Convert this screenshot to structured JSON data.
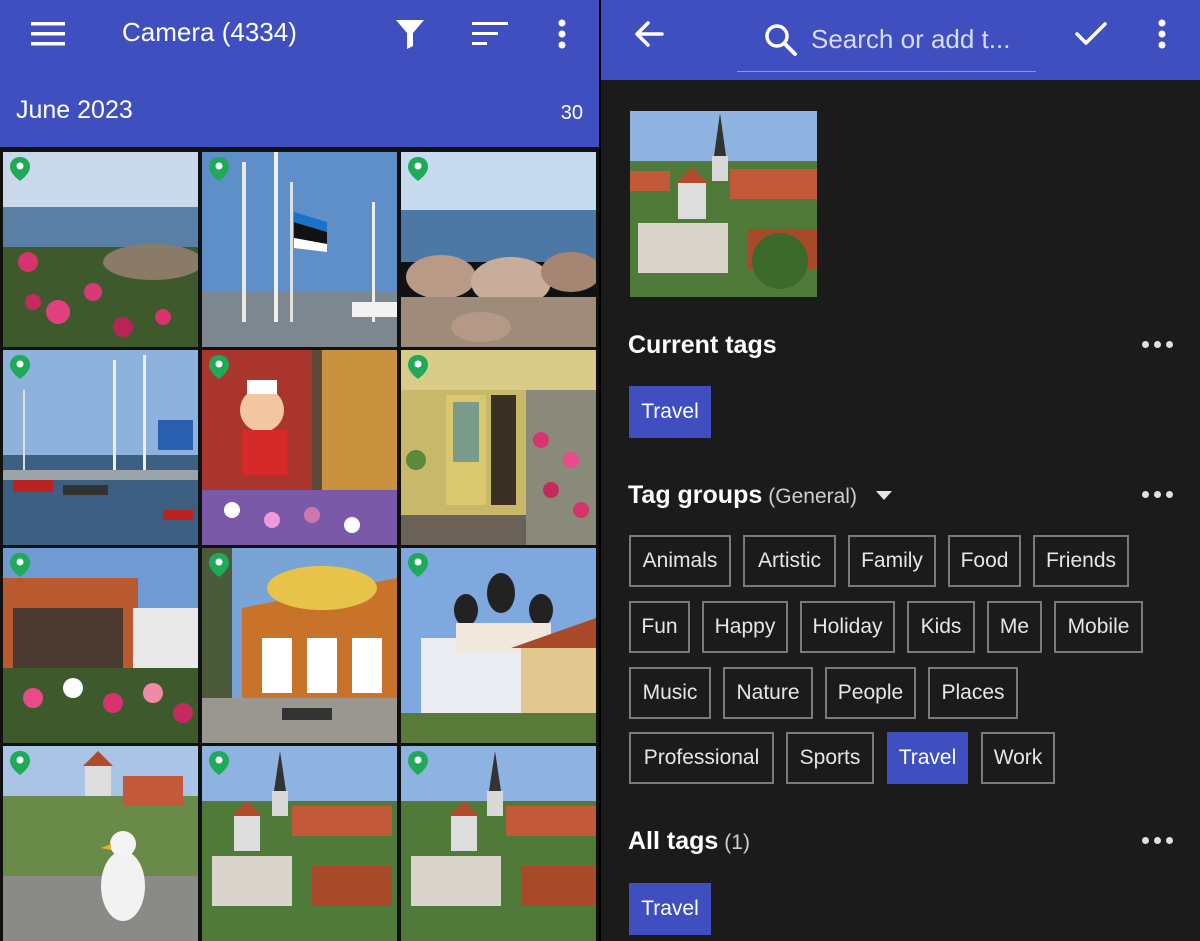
{
  "left": {
    "title": "Camera (4334)",
    "section": {
      "label": "June 2023",
      "count": "30"
    },
    "icons": {
      "menu": "menu-icon",
      "filter": "filter-icon",
      "sort": "sort-icon",
      "more": "more-vert-icon",
      "pin": "location-pin-icon"
    },
    "thumbnails": [
      "Coastline with pink roses",
      "Harbor flagpoles with Estonian flag",
      "Sea with boulders",
      "Marina with sailboats",
      "Shop window with painted chef and flowers",
      "Yellow building with flower stand",
      "Flower market stall",
      "Kalev kiosk building",
      "Orthodox cathedral with onion domes",
      "Seagull over Tallinn old town",
      "Tallinn old town rooftops view",
      "Tallinn old town panorama"
    ]
  },
  "right": {
    "search_placeholder": "Search or add t...",
    "icons": {
      "back": "arrow-back-icon",
      "search": "search-icon",
      "done": "check-icon",
      "more": "more-vert-icon",
      "dropdown": "dropdown-arrow-icon",
      "more_horiz": "more-horiz-icon"
    },
    "current_tags": {
      "title": "Current tags",
      "tags": [
        "Travel"
      ]
    },
    "tag_groups": {
      "title": "Tag groups",
      "group": "(General)",
      "tags": [
        "Animals",
        "Artistic",
        "Family",
        "Food",
        "Friends",
        "Fun",
        "Happy",
        "Holiday",
        "Kids",
        "Me",
        "Mobile",
        "Music",
        "Nature",
        "People",
        "Places",
        "Professional",
        "Sports",
        "Travel",
        "Work"
      ],
      "selected": "Travel"
    },
    "all_tags": {
      "title": "All tags",
      "count": "(1)",
      "tags": [
        "Travel"
      ]
    }
  },
  "colors": {
    "accent": "#3f4fbf",
    "pin": "#1faa59",
    "panel_dark": "#1b1b1b"
  }
}
